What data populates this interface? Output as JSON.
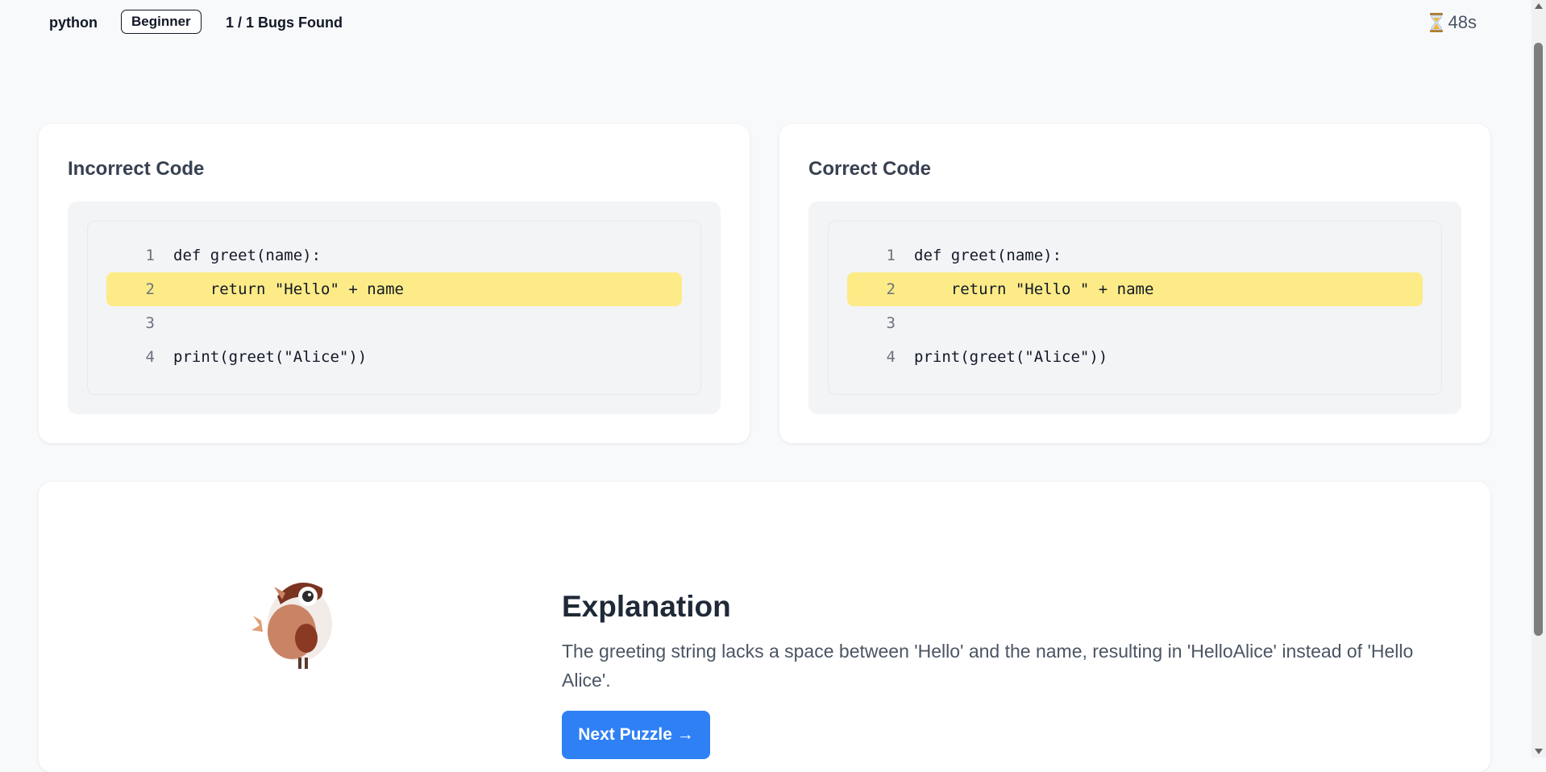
{
  "header": {
    "language": "python",
    "level": "Beginner",
    "bugs_found": "1 / 1 Bugs Found",
    "timer": "48s",
    "timer_icon": "hourglass-icon"
  },
  "incorrect": {
    "title": "Incorrect Code",
    "lines": [
      {
        "num": "1",
        "code": "def greet(name):"
      },
      {
        "num": "2",
        "code": "    return \"Hello\" + name"
      },
      {
        "num": "3",
        "code": ""
      },
      {
        "num": "4",
        "code": "print(greet(\"Alice\"))"
      }
    ],
    "highlight_line": 2
  },
  "correct": {
    "title": "Correct Code",
    "lines": [
      {
        "num": "1",
        "code": "def greet(name):"
      },
      {
        "num": "2",
        "code": "    return \"Hello \" + name"
      },
      {
        "num": "3",
        "code": ""
      },
      {
        "num": "4",
        "code": "print(greet(\"Alice\"))"
      }
    ],
    "highlight_line": 2
  },
  "explanation": {
    "title": "Explanation",
    "text": "The greeting string lacks a space between 'Hello' and the name, resulting in 'HelloAlice' instead of 'Hello Alice'.",
    "next_button": "Next Puzzle →",
    "mascot_icon": "bird-mascot-icon"
  },
  "colors": {
    "accent": "#2f80f5",
    "highlight": "#fdeb87",
    "background": "#f8f9fb"
  }
}
